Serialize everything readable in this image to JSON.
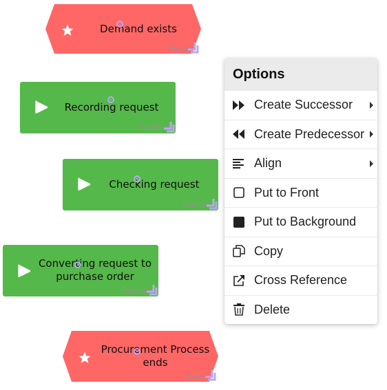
{
  "colors": {
    "event": "#ff6666",
    "function": "#55b84a",
    "menu_header_bg": "#ebebeb",
    "anchor": "#b9a7f0"
  },
  "nodes": [
    {
      "label": "Demand exists",
      "type": "Event",
      "icon": "star-icon"
    },
    {
      "label": "Recording request",
      "type": "Function",
      "icon": "play-icon"
    },
    {
      "label": "Checking request",
      "type": "Function",
      "icon": "play-icon"
    },
    {
      "label": "Converting request to purchase order",
      "type": "Function",
      "icon": "play-icon"
    },
    {
      "label": "Procurement Process ends",
      "type": "Event",
      "icon": "star-icon"
    }
  ],
  "menu": {
    "title": "Options",
    "items": [
      {
        "label": "Create Successor",
        "icon": "fast-forward-icon",
        "submenu": true
      },
      {
        "label": "Create Predecessor",
        "icon": "rewind-icon",
        "submenu": true
      },
      {
        "label": "Align",
        "icon": "align-icon",
        "submenu": true
      },
      {
        "label": "Put to Front",
        "icon": "square-outline-icon",
        "submenu": false
      },
      {
        "label": "Put to Background",
        "icon": "square-filled-icon",
        "submenu": false
      },
      {
        "label": "Copy",
        "icon": "copy-icon",
        "submenu": false
      },
      {
        "label": "Cross Reference",
        "icon": "external-link-icon",
        "submenu": false
      },
      {
        "label": "Delete",
        "icon": "trash-icon",
        "submenu": false
      }
    ]
  }
}
